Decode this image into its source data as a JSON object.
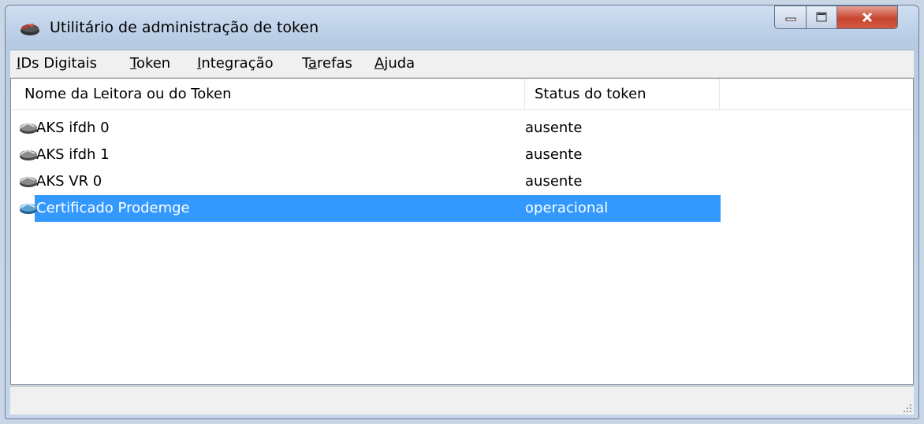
{
  "window": {
    "title": "Utilitário de administração de token"
  },
  "menu": [
    {
      "accel": "I",
      "rest": "Ds Digitais"
    },
    {
      "accel": "T",
      "rest": "oken"
    },
    {
      "accel": "I",
      "rest": "ntegração"
    },
    {
      "pre": "T",
      "accel": "a",
      "rest": "refas"
    },
    {
      "accel": "A",
      "rest": "juda"
    }
  ],
  "table": {
    "columns": [
      "Nome da Leitora ou do Token",
      "Status do token"
    ],
    "rows": [
      {
        "name": "AKS ifdh 0",
        "status": "ausente",
        "icon": "card-reader-icon"
      },
      {
        "name": "AKS ifdh 1",
        "status": "ausente",
        "icon": "card-reader-icon"
      },
      {
        "name": "AKS VR 0",
        "status": "ausente",
        "icon": "card-reader-icon"
      },
      {
        "name": "Certificado Prodemge",
        "status": "operacional",
        "icon": "active-token-icon",
        "selected": true
      }
    ]
  },
  "colors": {
    "selection": "#3399ff",
    "close_button": "#c7462f"
  }
}
